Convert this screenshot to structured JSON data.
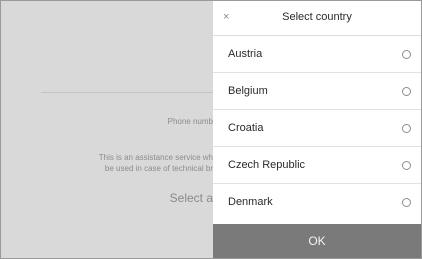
{
  "background": {
    "phone_label": "Phone numb",
    "description_line1": "This is an assistance service wh",
    "description_line2": "be used in case of technical br",
    "select_label": "Select a"
  },
  "dialog": {
    "title": "Select country",
    "close_glyph": "×",
    "countries": [
      {
        "label": "Austria",
        "selected": false
      },
      {
        "label": "Belgium",
        "selected": false
      },
      {
        "label": "Croatia",
        "selected": false
      },
      {
        "label": "Czech Republic",
        "selected": false
      },
      {
        "label": "Denmark",
        "selected": false
      }
    ],
    "ok_label": "OK"
  },
  "colors": {
    "overlay": "#d9d9d9",
    "ok_button": "#7a7a7a"
  }
}
